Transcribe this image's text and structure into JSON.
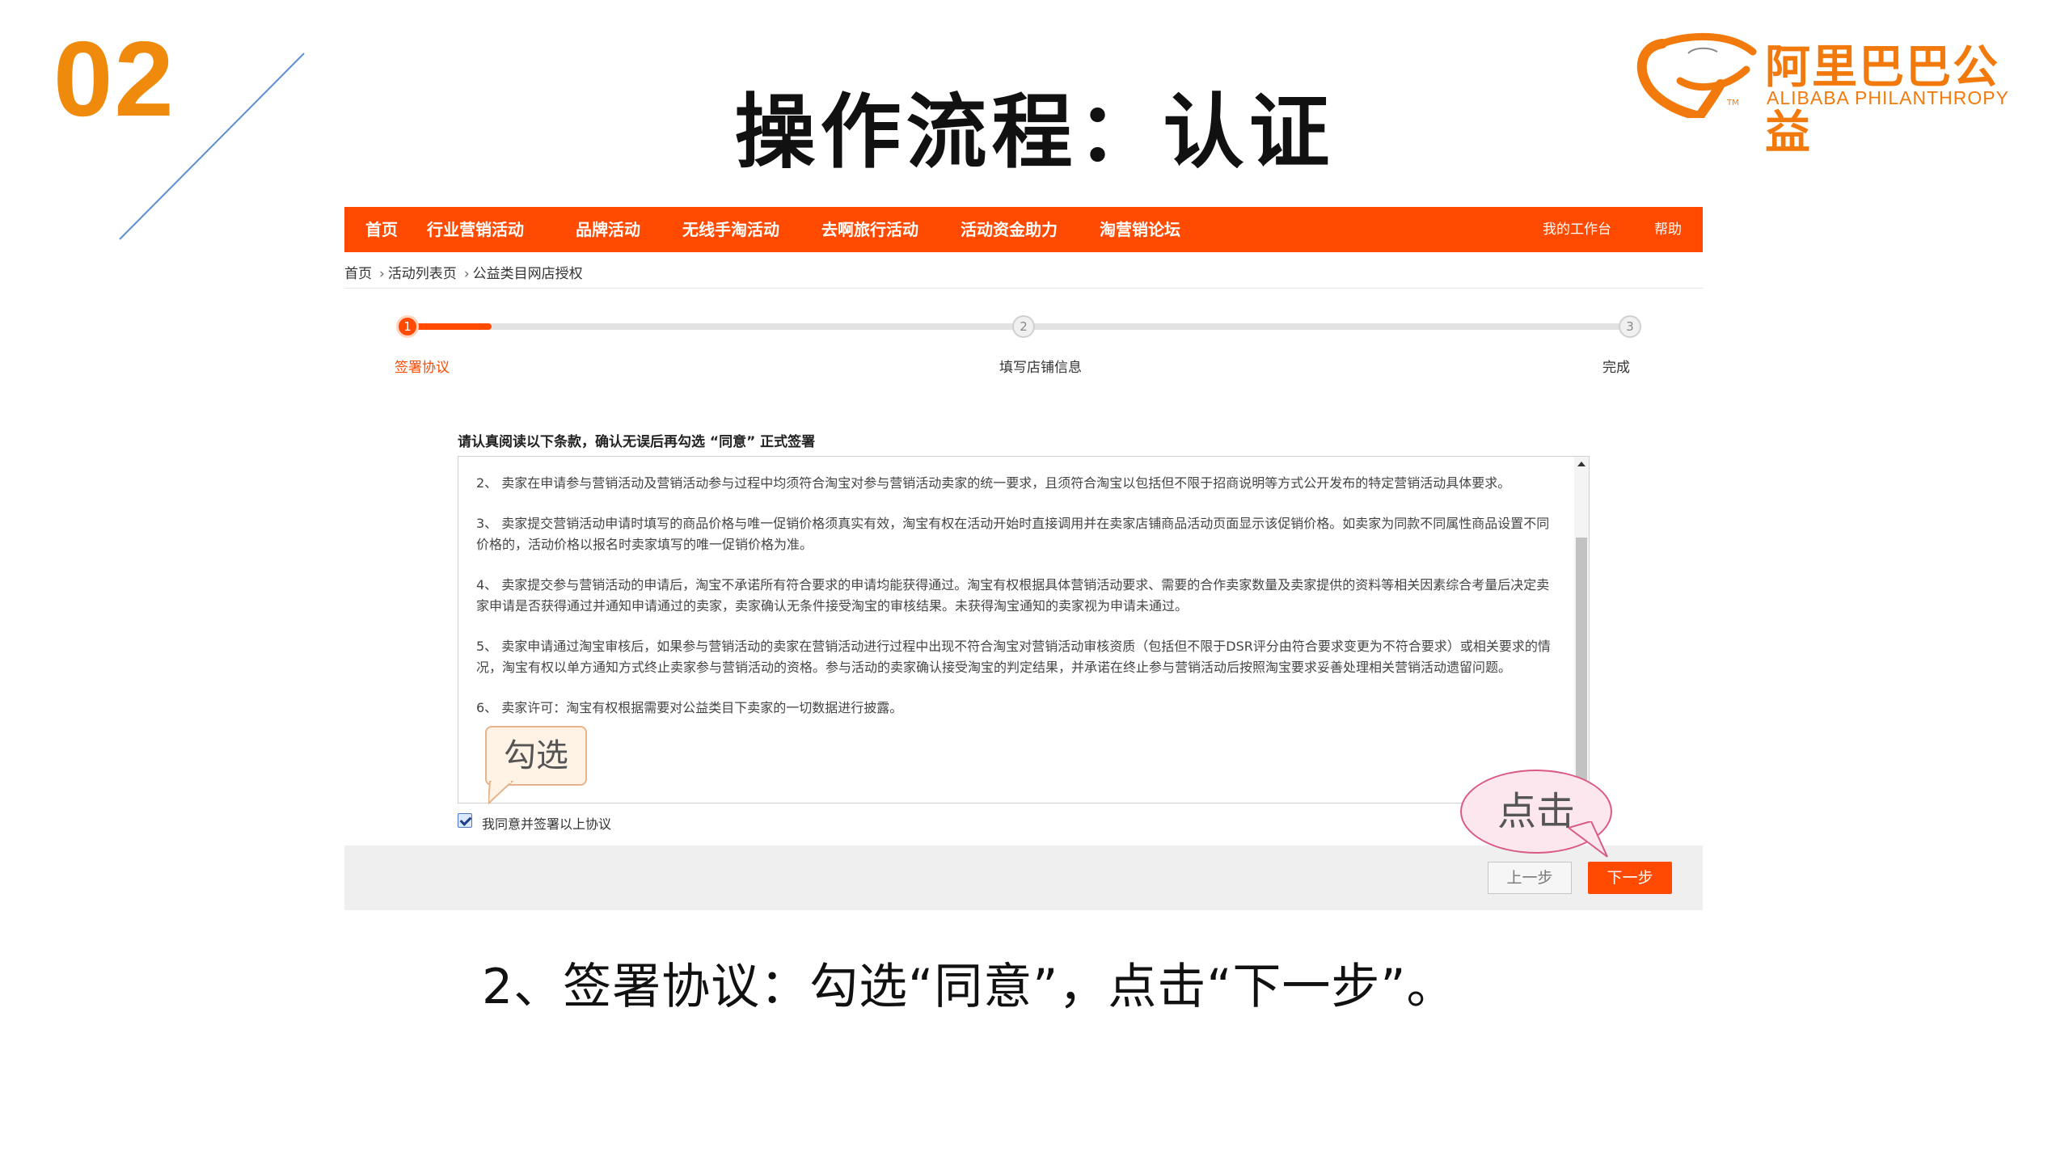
{
  "slide": {
    "number": "02",
    "title": "操作流程：认证",
    "caption": "2、签署协议：勾选“同意”，点击“下一步”。"
  },
  "logo": {
    "cn": "阿里巴巴公益",
    "en": "ALIBABA PHILANTHROPY",
    "tm": "TM"
  },
  "navbar": {
    "items": [
      "首页",
      "行业营销活动",
      "品牌活动",
      "无线手淘活动",
      "去啊旅行活动",
      "活动资金助力",
      "淘营销论坛"
    ],
    "right": [
      "我的工作台",
      "帮助"
    ]
  },
  "breadcrumb": [
    "首页",
    "活动列表页",
    "公益类目网店授权"
  ],
  "steps": [
    {
      "num": "1",
      "label": "签署协议",
      "state": "active"
    },
    {
      "num": "2",
      "label": "填写店铺信息",
      "state": "idle"
    },
    {
      "num": "3",
      "label": "完成",
      "state": "idle"
    }
  ],
  "instruction": "请认真阅读以下条款，确认无误后再勾选 “同意” 正式签署",
  "terms": [
    "2、 卖家在申请参与营销活动及营销活动参与过程中均须符合淘宝对参与营销活动卖家的统一要求，且须符合淘宝以包括但不限于招商说明等方式公开发布的特定营销活动具体要求。",
    "3、 卖家提交营销活动申请时填写的商品价格与唯一促销价格须真实有效，淘宝有权在活动开始时直接调用并在卖家店铺商品活动页面显示该促销价格。如卖家为同款不同属性商品设置不同价格的，活动价格以报名时卖家填写的唯一促销价格为准。",
    "4、 卖家提交参与营销活动的申请后，淘宝不承诺所有符合要求的申请均能获得通过。淘宝有权根据具体营销活动要求、需要的合作卖家数量及卖家提供的资料等相关因素综合考量后决定卖家申请是否获得通过并通知申请通过的卖家，卖家确认无条件接受淘宝的审核结果。未获得淘宝通知的卖家视为申请未通过。",
    "5、 卖家申请通过淘宝审核后，如果参与营销活动的卖家在营销活动进行过程中出现不符合淘宝对营销活动审核资质（包括但不限于DSR评分由符合要求变更为不符合要求）或相关要求的情况，淘宝有权以单方通知方式终止卖家参与营销活动的资格。参与活动的卖家确认接受淘宝的判定结果，并承诺在终止参与营销活动后按照淘宝要求妥善处理相关营销活动遗留问题。",
    "6、 卖家许可：淘宝有权根据需要对公益类目下卖家的一切数据进行披露。"
  ],
  "agree_label": "我同意并签署以上协议",
  "buttons": {
    "prev": "上一步",
    "next": "下一步"
  },
  "callouts": {
    "check": "勾选",
    "click": "点击"
  },
  "colors": {
    "accent": "#ff4a00",
    "slide_number": "#f08a0c",
    "deco_line": "#5b8fd0"
  }
}
